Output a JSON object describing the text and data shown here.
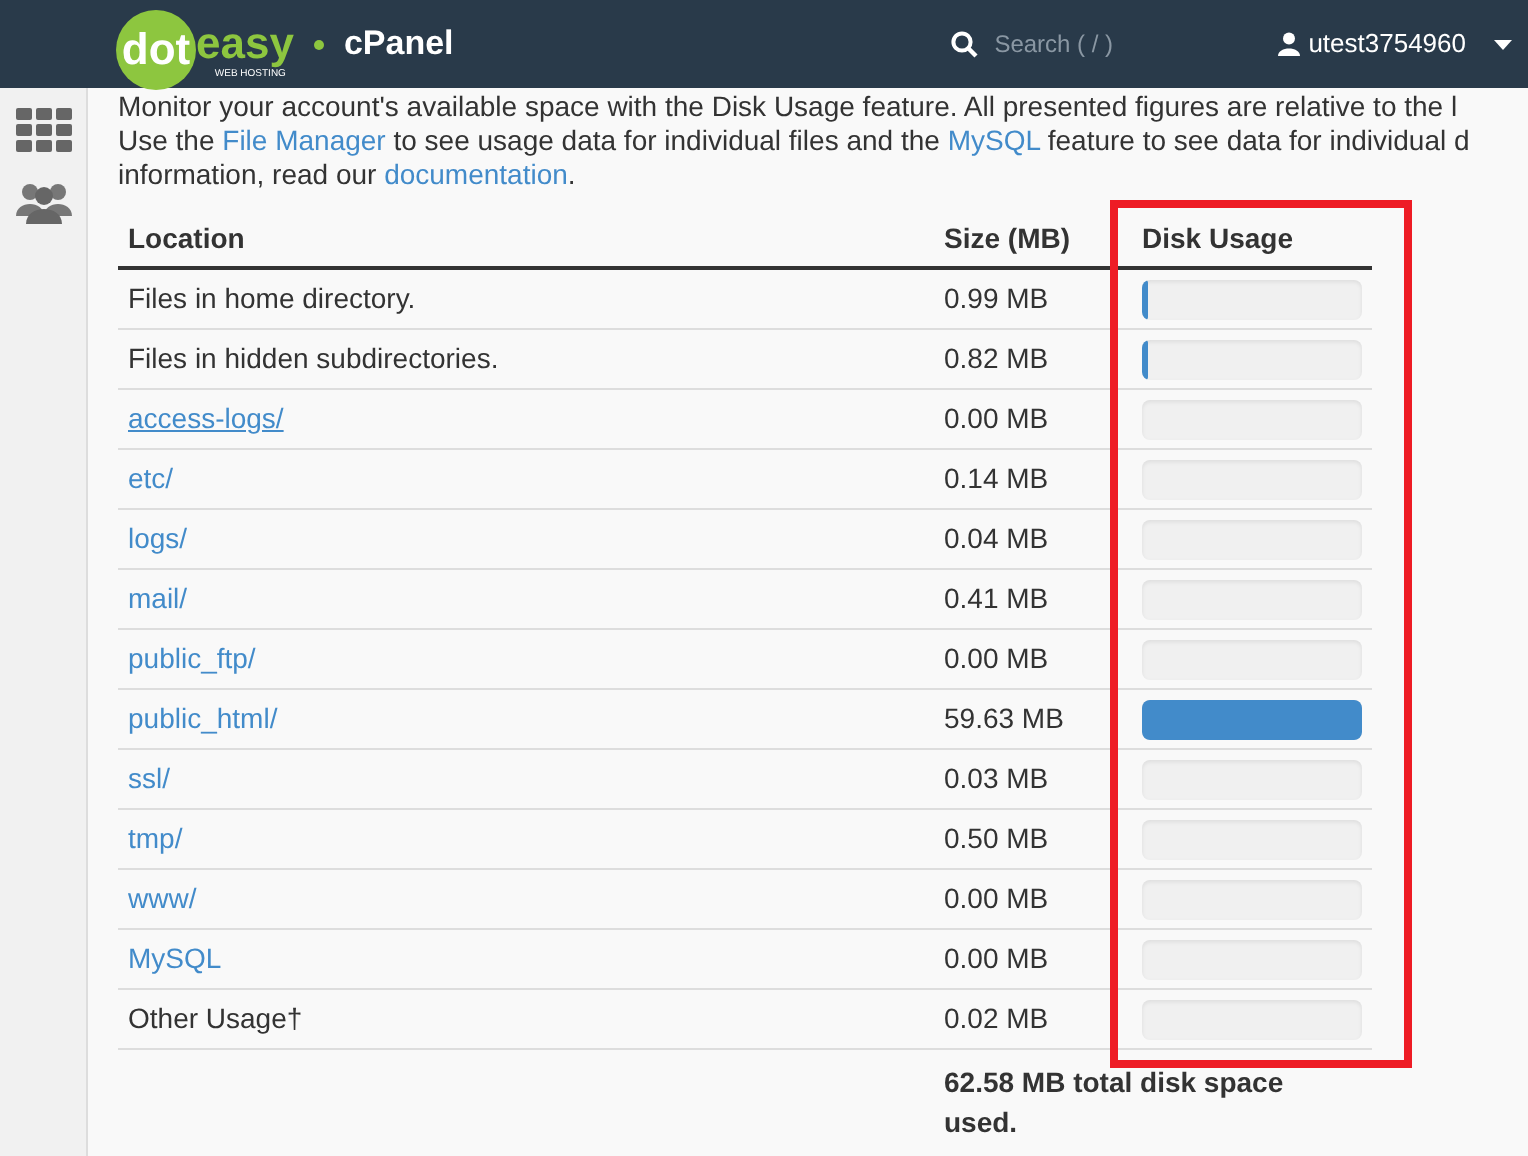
{
  "header": {
    "logo": {
      "word_1": "dot",
      "word_2": "easy",
      "tagline": "WEB HOSTING"
    },
    "product": "cPanel",
    "search": {
      "placeholder": "Search ( / )"
    },
    "user": "utest3754960"
  },
  "intro": [
    [
      {
        "text": "Monitor your account's available space with the Disk Usage feature. All presented figures are relative to the l",
        "kind": "text"
      }
    ],
    [
      {
        "text": "Use the ",
        "kind": "text"
      },
      {
        "text": "File Manager",
        "kind": "link"
      },
      {
        "text": " to see usage data for individual files and the ",
        "kind": "text"
      },
      {
        "text": "MySQL",
        "kind": "link"
      },
      {
        "text": " feature to see data for individual d",
        "kind": "text"
      }
    ],
    [
      {
        "text": "information, read our ",
        "kind": "text"
      },
      {
        "text": "documentation",
        "kind": "link"
      },
      {
        "text": ".",
        "kind": "text"
      }
    ]
  ],
  "table": {
    "columns": [
      "Location",
      "Size (MB)",
      "Disk Usage"
    ],
    "rows": [
      {
        "location": "Files in home directory.",
        "kind": "text",
        "size": "0.99 MB",
        "level": 0.02
      },
      {
        "location": "Files in hidden subdirectories.",
        "kind": "text",
        "size": "0.82 MB",
        "level": 0.02
      },
      {
        "location": "access-logs/",
        "kind": "link",
        "underlined": true,
        "size": "0.00 MB",
        "level": 0
      },
      {
        "location": "etc/",
        "kind": "link",
        "underlined": false,
        "size": "0.14 MB",
        "level": 0
      },
      {
        "location": "logs/",
        "kind": "link",
        "underlined": false,
        "size": "0.04 MB",
        "level": 0
      },
      {
        "location": "mail/",
        "kind": "link",
        "underlined": false,
        "size": "0.41 MB",
        "level": 0
      },
      {
        "location": "public_ftp/",
        "kind": "link",
        "underlined": false,
        "size": "0.00 MB",
        "level": 0
      },
      {
        "location": "public_html/",
        "kind": "link",
        "underlined": false,
        "size": "59.63 MB",
        "level": 1
      },
      {
        "location": "ssl/",
        "kind": "link",
        "underlined": false,
        "size": "0.03 MB",
        "level": 0
      },
      {
        "location": "tmp/",
        "kind": "link",
        "underlined": false,
        "size": "0.50 MB",
        "level": 0
      },
      {
        "location": "www/",
        "kind": "link",
        "underlined": false,
        "size": "0.00 MB",
        "level": 0
      },
      {
        "location": "MySQL",
        "kind": "link",
        "underlined": false,
        "size": "0.00 MB",
        "level": 0
      },
      {
        "location": "Other Usage†",
        "kind": "text",
        "size": "0.02 MB",
        "level": 0
      }
    ],
    "total": "62.58 MB total disk space used."
  }
}
